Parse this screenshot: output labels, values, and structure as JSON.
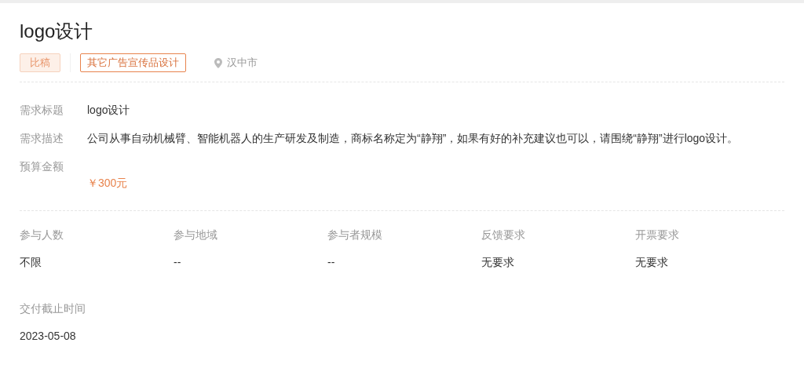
{
  "title": "logo设计",
  "tags": [
    {
      "label": "比稿",
      "kind": "filled"
    },
    {
      "label": "其它广告宣传品设计",
      "kind": "outline"
    }
  ],
  "location": "汉中市",
  "details": [
    {
      "label": "需求标题",
      "value": "logo设计",
      "kind": "plain"
    },
    {
      "label": "需求描述",
      "value": "公司从事自动机械臂、智能机器人的生产研发及制造，商标名称定为“静翔”，如果有好的补充建议也可以，请围绕“静翔”进行logo设计。",
      "kind": "plain"
    },
    {
      "label": "预算金额",
      "value": "￥300元",
      "kind": "price"
    }
  ],
  "requirements": [
    {
      "label": "参与人数",
      "value": "不限"
    },
    {
      "label": "参与地域",
      "value": "--"
    },
    {
      "label": "参与者规模",
      "value": "--"
    },
    {
      "label": "反馈要求",
      "value": "无要求"
    },
    {
      "label": "开票要求",
      "value": "无要求"
    }
  ],
  "deadline": {
    "label": "交付截止时间",
    "value": "2023-05-08"
  }
}
